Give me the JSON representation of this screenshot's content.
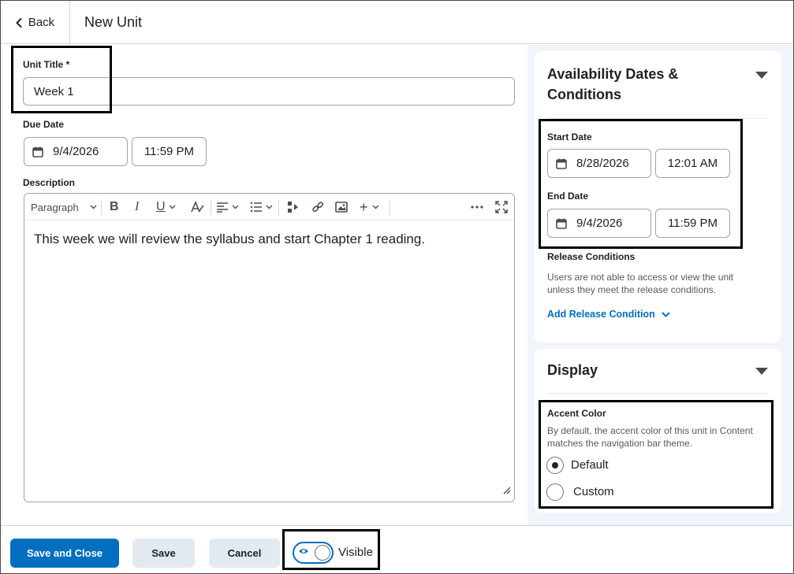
{
  "header": {
    "back_label": "Back",
    "title": "New Unit"
  },
  "form": {
    "unit_title_label": "Unit Title *",
    "unit_title_value": "Week 1",
    "due_date_label": "Due Date",
    "due_date_value": "9/4/2026",
    "due_time_value": "11:59 PM",
    "description_label": "Description",
    "editor": {
      "block_format": "Paragraph",
      "content": "This week we will review the syllabus and start Chapter 1 reading."
    }
  },
  "availability": {
    "title_line1": "Availability Dates &",
    "title_line2": "Conditions",
    "start_date_label": "Start Date",
    "start_date_value": "8/28/2026",
    "start_time_value": "12:01 AM",
    "end_date_label": "End Date",
    "end_date_value": "9/4/2026",
    "end_time_value": "11:59 PM",
    "release_conditions_label": "Release Conditions",
    "release_help_line1": "Users are not able to access or view the unit",
    "release_help_line2": "unless they meet the release conditions.",
    "add_release_condition": "Add Release Condition"
  },
  "display": {
    "title": "Display",
    "accent_color_label": "Accent Color",
    "accent_help_line1": "By default, the accent color of this unit in Content",
    "accent_help_line2": "matches the navigation bar theme.",
    "options": [
      {
        "label": "Default",
        "checked": true
      },
      {
        "label": "Custom",
        "checked": false
      }
    ]
  },
  "footer": {
    "save_close": "Save and Close",
    "save": "Save",
    "cancel": "Cancel",
    "visible_label": "Visible",
    "visible": true
  },
  "colors": {
    "primary": "#006fbf",
    "panel_bg": "#f1f5fb",
    "highlight_border": "#000000"
  }
}
